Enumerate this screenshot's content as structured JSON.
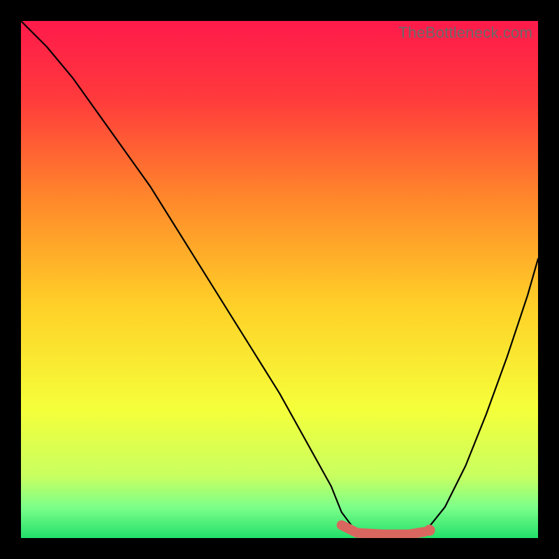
{
  "watermark": "TheBottleneck.com",
  "gradient": {
    "stops": [
      {
        "offset": 0.0,
        "color": "#ff1a4b"
      },
      {
        "offset": 0.15,
        "color": "#ff3a3c"
      },
      {
        "offset": 0.35,
        "color": "#ff8a2a"
      },
      {
        "offset": 0.55,
        "color": "#ffd028"
      },
      {
        "offset": 0.75,
        "color": "#f5ff3a"
      },
      {
        "offset": 0.88,
        "color": "#c8ff60"
      },
      {
        "offset": 0.94,
        "color": "#7dff8a"
      },
      {
        "offset": 1.0,
        "color": "#22e06a"
      }
    ]
  },
  "chart_data": {
    "type": "line",
    "title": "",
    "xlabel": "",
    "ylabel": "",
    "xlim": [
      0,
      100
    ],
    "ylim": [
      0,
      100
    ],
    "series": [
      {
        "name": "bottleneck-curve",
        "x": [
          0,
          5,
          10,
          15,
          20,
          25,
          30,
          35,
          40,
          45,
          50,
          55,
          60,
          62,
          65,
          70,
          75,
          78,
          82,
          86,
          90,
          94,
          98,
          100
        ],
        "y": [
          100,
          95,
          89,
          82,
          75,
          68,
          60,
          52,
          44,
          36,
          28,
          19,
          10,
          5,
          1,
          0.5,
          0.5,
          1,
          6,
          14,
          24,
          35,
          47,
          54
        ]
      }
    ],
    "highlight": {
      "name": "optimal-range",
      "color": "#d9675f",
      "x": [
        62,
        65,
        70,
        75,
        78
      ],
      "y": [
        2.5,
        1.0,
        0.7,
        0.7,
        1.2
      ],
      "marker_x": 79,
      "marker_y": 1.5
    }
  }
}
